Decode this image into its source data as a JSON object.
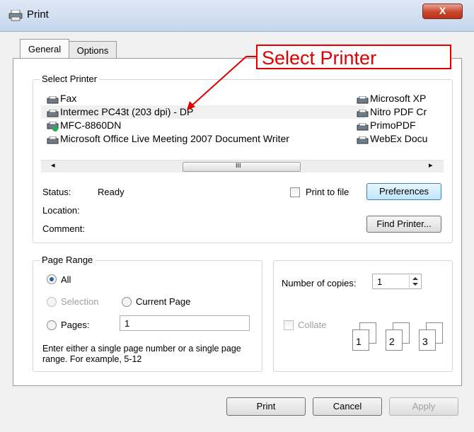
{
  "window": {
    "title": "Print",
    "close_symbol": "X"
  },
  "tabs": [
    {
      "label": "General"
    },
    {
      "label": "Options"
    }
  ],
  "annotation": {
    "label": "Select Printer"
  },
  "select_printer": {
    "group_label": "Select Printer",
    "printers_left": [
      {
        "name": "Fax"
      },
      {
        "name": "Intermec PC43t (203 dpi) - DP"
      },
      {
        "name": "MFC-8860DN"
      },
      {
        "name": "Microsoft Office Live Meeting 2007 Document Writer"
      }
    ],
    "printers_right": [
      {
        "name": "Microsoft XP"
      },
      {
        "name": "Nitro PDF Cr"
      },
      {
        "name": "PrimoPDF"
      },
      {
        "name": "WebEx Docu"
      }
    ],
    "scroll_left": "◂",
    "scroll_right": "▸",
    "scroll_grip": "III"
  },
  "status": {
    "status_label": "Status:",
    "status_value": "Ready",
    "location_label": "Location:",
    "comment_label": "Comment:",
    "print_to_file_label": "Print to file",
    "preferences_label": "Preferences",
    "find_printer_label": "Find Printer..."
  },
  "page_range": {
    "group_label": "Page Range",
    "all_label": "All",
    "selection_label": "Selection",
    "current_page_label": "Current Page",
    "pages_label": "Pages:",
    "pages_value": "1",
    "hint": "Enter either a single page number or a single page range.  For example, 5-12"
  },
  "copies": {
    "number_label": "Number of copies:",
    "number_value": "1",
    "collate_label": "Collate",
    "collate_pages": [
      "1",
      "1",
      "2",
      "2",
      "3",
      "3"
    ]
  },
  "buttons": {
    "print": "Print",
    "cancel": "Cancel",
    "apply": "Apply"
  },
  "colors": {
    "annotation_red": "#e00000",
    "titlebar": "#c4d6ec",
    "close_button": "#c9462c"
  }
}
